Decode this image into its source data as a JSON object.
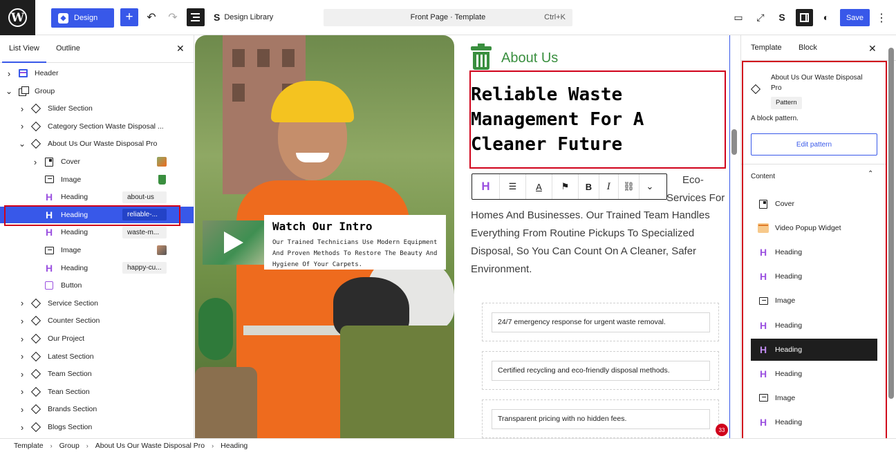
{
  "topbar": {
    "design_label": "Design",
    "library_label": "Design Library",
    "command_title": "Front Page · Template",
    "command_shortcut": "Ctrl+K",
    "save_label": "Save"
  },
  "left_panel": {
    "tabs": [
      "List View",
      "Outline"
    ],
    "tree": [
      {
        "label": "Header",
        "icon": "template-part-icon",
        "depth": 0,
        "chevron": "right"
      },
      {
        "label": "Group",
        "icon": "group-icon",
        "depth": 0,
        "chevron": "down"
      },
      {
        "label": "Slider Section",
        "icon": "pattern-icon",
        "depth": 1,
        "chevron": "right"
      },
      {
        "label": "Category Section Waste Disposal ...",
        "icon": "pattern-icon",
        "depth": 1,
        "chevron": "right"
      },
      {
        "label": "About Us Our Waste Disposal Pro",
        "icon": "pattern-icon",
        "depth": 1,
        "chevron": "down"
      },
      {
        "label": "Cover",
        "icon": "cover-icon",
        "depth": 2,
        "chevron": "right"
      },
      {
        "label": "Image",
        "icon": "image-icon",
        "depth": 2
      },
      {
        "label": "Heading",
        "icon": "heading-icon",
        "depth": 2,
        "badge": "about-us"
      },
      {
        "label": "Heading",
        "icon": "heading-icon",
        "depth": 2,
        "badge": "reliable-...",
        "selected": true
      },
      {
        "label": "Heading",
        "icon": "heading-icon",
        "depth": 2,
        "badge": "waste-m..."
      },
      {
        "label": "Image",
        "icon": "image-icon",
        "depth": 2
      },
      {
        "label": "Heading",
        "icon": "heading-icon",
        "depth": 2,
        "badge": "happy-cu..."
      },
      {
        "label": "Button",
        "icon": "button-icon",
        "depth": 2
      },
      {
        "label": "Service Section",
        "icon": "pattern-icon",
        "depth": 1,
        "chevron": "right"
      },
      {
        "label": "Counter Section",
        "icon": "pattern-icon",
        "depth": 1,
        "chevron": "right"
      },
      {
        "label": "Our Project",
        "icon": "pattern-icon",
        "depth": 1,
        "chevron": "right"
      },
      {
        "label": "Latest Section",
        "icon": "pattern-icon",
        "depth": 1,
        "chevron": "right"
      },
      {
        "label": "Team Section",
        "icon": "pattern-icon",
        "depth": 1,
        "chevron": "right"
      },
      {
        "label": "Tean Section",
        "icon": "pattern-icon",
        "depth": 1,
        "chevron": "right"
      },
      {
        "label": "Brands Section",
        "icon": "pattern-icon",
        "depth": 1,
        "chevron": "right"
      },
      {
        "label": "Blogs Section",
        "icon": "pattern-icon",
        "depth": 1,
        "chevron": "right"
      }
    ]
  },
  "canvas": {
    "intro_title": "Watch Our Intro",
    "intro_text": "Our Trained Technicians Use Modern Equipment And Proven Methods To Restore The Beauty And Hygiene Of Your Carpets.",
    "about_label": "About Us",
    "heading": "Reliable Waste Management For A Cleaner Future",
    "body_line1": "Eco-",
    "body_line2": "Services For",
    "body_rest": "Homes And Businesses. Our Trained Team Handles Everything From Routine Pickups To Specialized Disposal, So You Can Count On A Cleaner, Safer Environment.",
    "features": [
      "24/7 emergency response for urgent waste removal.",
      "Certified recycling and eco-friendly disposal methods.",
      "Transparent pricing with no hidden fees."
    ],
    "notification_count": "33"
  },
  "right_panel": {
    "tabs": [
      "Template",
      "Block"
    ],
    "block_name": "About Us Our Waste Disposal Pro",
    "pattern_badge": "Pattern",
    "description": "A block pattern.",
    "edit_label": "Edit pattern",
    "content_header": "Content",
    "content_items": [
      {
        "label": "Cover",
        "icon": "cover-icon"
      },
      {
        "label": "Video Popup Widget",
        "icon": "video-popup-icon"
      },
      {
        "label": "Heading",
        "icon": "heading-icon"
      },
      {
        "label": "Heading",
        "icon": "heading-icon"
      },
      {
        "label": "Image",
        "icon": "image-icon"
      },
      {
        "label": "Heading",
        "icon": "heading-icon"
      },
      {
        "label": "Heading",
        "icon": "heading-icon",
        "active": true
      },
      {
        "label": "Heading",
        "icon": "heading-icon"
      },
      {
        "label": "Image",
        "icon": "image-icon"
      },
      {
        "label": "Heading",
        "icon": "heading-icon"
      }
    ]
  },
  "breadcrumb": [
    "Template",
    "Group",
    "About Us Our Waste Disposal Pro",
    "Heading"
  ],
  "colors": {
    "accent": "#3858e9",
    "highlight": "#d0021b",
    "brand_green": "#3a8f3f",
    "heading_icon": "#9b51e0"
  }
}
